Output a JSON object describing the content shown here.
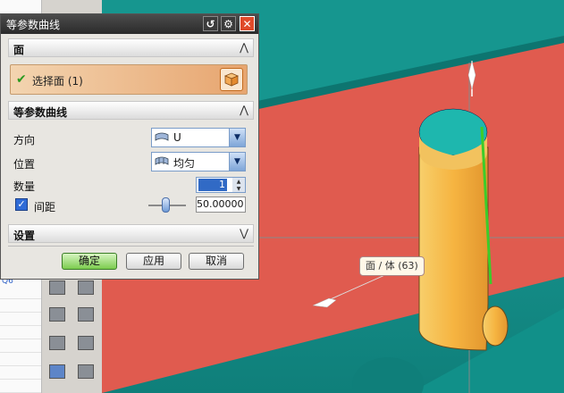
{
  "dialog": {
    "title": "等参数曲线",
    "sections": {
      "face": {
        "label": "面",
        "select_label": "选择面 (1)"
      },
      "iso": {
        "label": "等参数曲线"
      },
      "settings": {
        "label": "设置"
      }
    },
    "fields": {
      "direction": {
        "label": "方向",
        "value": "U"
      },
      "position": {
        "label": "位置",
        "value": "均匀"
      },
      "count": {
        "label": "数量",
        "value": "1"
      },
      "spacing": {
        "label": "间距",
        "checked": true,
        "value": "50.00000"
      }
    },
    "buttons": {
      "ok": "确定",
      "apply": "应用",
      "cancel": "取消"
    }
  },
  "viewport": {
    "tooltip": "面 / 体 (63)",
    "colors": {
      "background": "#2aa39c",
      "plane": "#e05b4f",
      "body": "#f2b24a",
      "highlight": "#4caf50"
    }
  },
  "left_panel": {
    "text": "Q6"
  },
  "icons": [
    "reset-icon",
    "gear-icon",
    "close-icon",
    "face-cube-icon",
    "direction-icon",
    "position-icon",
    "chevron-up-icon",
    "chevron-down-icon",
    "checkmark-icon"
  ]
}
